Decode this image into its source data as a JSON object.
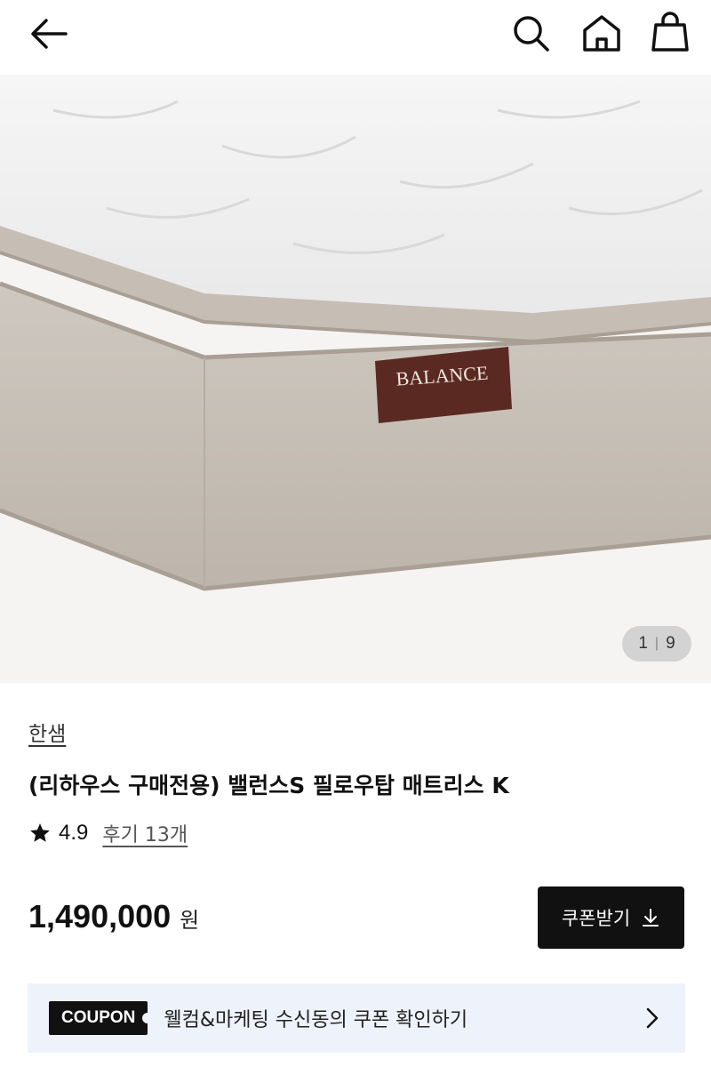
{
  "header": {
    "back_icon": "arrow-left-icon",
    "search_icon": "search-icon",
    "home_icon": "home-icon",
    "bag_icon": "shopping-bag-icon"
  },
  "gallery": {
    "label_text": "BALANCE",
    "current": "1",
    "total": "9"
  },
  "product": {
    "brand": "한샘",
    "title": "(리하우스 구매전용) 밸런스S 필로우탑 매트리스 K",
    "rating": "4.9",
    "reviews": "후기 13개",
    "price": "1,490,000",
    "price_unit": "원"
  },
  "actions": {
    "coupon_button": "쿠폰받기"
  },
  "banner": {
    "badge": "COUPON",
    "text": "웰컴&마케팅 수신동의 쿠폰 확인하기"
  },
  "colors": {
    "accent": "#111111",
    "banner_bg": "#eef2fb",
    "label_bg": "#5a2a22"
  }
}
